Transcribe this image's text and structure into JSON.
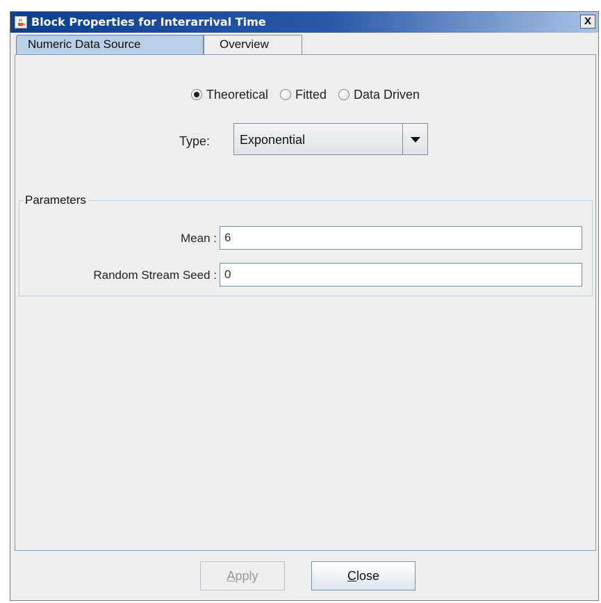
{
  "window": {
    "title": "Block Properties for Interarrival Time",
    "app_icon": "java-coffee-cup-icon",
    "close_symbol": "X"
  },
  "tabs": [
    {
      "label": "Numeric Data Source",
      "active": true
    },
    {
      "label": "Overview",
      "active": false
    }
  ],
  "source_mode": {
    "options": [
      {
        "label": "Theoretical",
        "checked": true
      },
      {
        "label": "Fitted",
        "checked": false
      },
      {
        "label": "Data Driven",
        "checked": false
      }
    ]
  },
  "type": {
    "label": "Type:",
    "selected": "Exponential"
  },
  "parameters": {
    "title": "Parameters",
    "fields": [
      {
        "label": "Mean :",
        "value": "6"
      },
      {
        "label": "Random Stream Seed :",
        "value": "0"
      }
    ]
  },
  "buttons": {
    "apply": {
      "mnemonic": "A",
      "rest": "pply",
      "enabled": false
    },
    "close": {
      "mnemonic": "C",
      "rest": "lose",
      "enabled": true
    }
  },
  "colors": {
    "titlebar_start": "#0b3f8f",
    "titlebar_end": "#a9c3e6",
    "active_tab": "#b8cfe5",
    "background": "#eeeeee"
  }
}
